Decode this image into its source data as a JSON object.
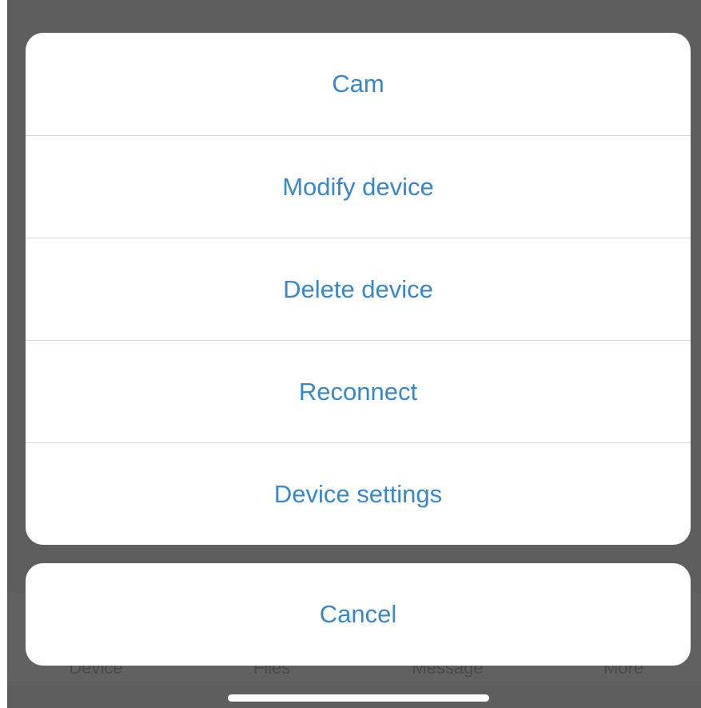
{
  "action_sheet": {
    "actions": [
      {
        "label": "Cam"
      },
      {
        "label": "Modify device"
      },
      {
        "label": "Delete device"
      },
      {
        "label": "Reconnect"
      },
      {
        "label": "Device settings"
      }
    ],
    "cancel_label": "Cancel"
  },
  "tabbar": {
    "tabs": [
      {
        "label": "Device"
      },
      {
        "label": "Files"
      },
      {
        "label": "Message"
      },
      {
        "label": "More"
      }
    ]
  },
  "colors": {
    "accent": "#3b86c4",
    "overlay": "#5e5e5e",
    "sheet_background": "#ffffff",
    "separator": "#d8d8d8"
  }
}
